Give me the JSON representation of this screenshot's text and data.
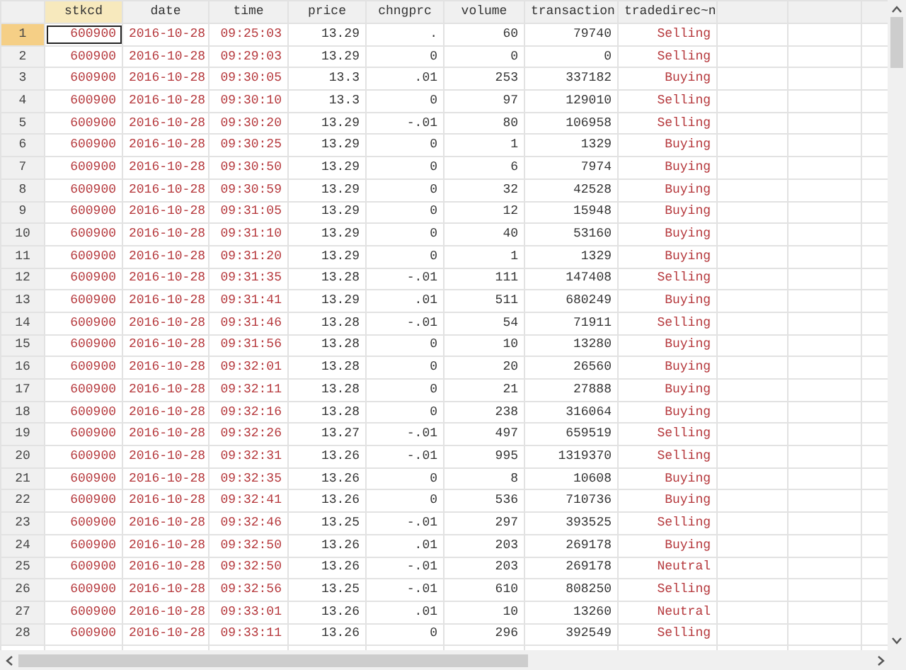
{
  "columns": [
    {
      "label": "stkcd",
      "kind": "string",
      "selected": true
    },
    {
      "label": "date",
      "kind": "string",
      "selected": false
    },
    {
      "label": "time",
      "kind": "string",
      "selected": false
    },
    {
      "label": "price",
      "kind": "numeric",
      "selected": false
    },
    {
      "label": "chngprc",
      "kind": "numeric",
      "selected": false
    },
    {
      "label": "volume",
      "kind": "numeric",
      "selected": false
    },
    {
      "label": "transaction",
      "kind": "numeric",
      "selected": false
    },
    {
      "label": "tradedirec~n",
      "kind": "string",
      "selected": false
    }
  ],
  "rows": [
    {
      "number": "1",
      "selected": true,
      "cells": [
        "600900",
        "2016-10-28",
        "09:25:03",
        "13.29",
        ".",
        "60",
        "79740",
        "Selling"
      ]
    },
    {
      "number": "2",
      "selected": false,
      "cells": [
        "600900",
        "2016-10-28",
        "09:29:03",
        "13.29",
        "0",
        "0",
        "0",
        "Selling"
      ]
    },
    {
      "number": "3",
      "selected": false,
      "cells": [
        "600900",
        "2016-10-28",
        "09:30:05",
        "13.3",
        ".01",
        "253",
        "337182",
        "Buying"
      ]
    },
    {
      "number": "4",
      "selected": false,
      "cells": [
        "600900",
        "2016-10-28",
        "09:30:10",
        "13.3",
        "0",
        "97",
        "129010",
        "Selling"
      ]
    },
    {
      "number": "5",
      "selected": false,
      "cells": [
        "600900",
        "2016-10-28",
        "09:30:20",
        "13.29",
        "-.01",
        "80",
        "106958",
        "Selling"
      ]
    },
    {
      "number": "6",
      "selected": false,
      "cells": [
        "600900",
        "2016-10-28",
        "09:30:25",
        "13.29",
        "0",
        "1",
        "1329",
        "Buying"
      ]
    },
    {
      "number": "7",
      "selected": false,
      "cells": [
        "600900",
        "2016-10-28",
        "09:30:50",
        "13.29",
        "0",
        "6",
        "7974",
        "Buying"
      ]
    },
    {
      "number": "8",
      "selected": false,
      "cells": [
        "600900",
        "2016-10-28",
        "09:30:59",
        "13.29",
        "0",
        "32",
        "42528",
        "Buying"
      ]
    },
    {
      "number": "9",
      "selected": false,
      "cells": [
        "600900",
        "2016-10-28",
        "09:31:05",
        "13.29",
        "0",
        "12",
        "15948",
        "Buying"
      ]
    },
    {
      "number": "10",
      "selected": false,
      "cells": [
        "600900",
        "2016-10-28",
        "09:31:10",
        "13.29",
        "0",
        "40",
        "53160",
        "Buying"
      ]
    },
    {
      "number": "11",
      "selected": false,
      "cells": [
        "600900",
        "2016-10-28",
        "09:31:20",
        "13.29",
        "0",
        "1",
        "1329",
        "Buying"
      ]
    },
    {
      "number": "12",
      "selected": false,
      "cells": [
        "600900",
        "2016-10-28",
        "09:31:35",
        "13.28",
        "-.01",
        "111",
        "147408",
        "Selling"
      ]
    },
    {
      "number": "13",
      "selected": false,
      "cells": [
        "600900",
        "2016-10-28",
        "09:31:41",
        "13.29",
        ".01",
        "511",
        "680249",
        "Buying"
      ]
    },
    {
      "number": "14",
      "selected": false,
      "cells": [
        "600900",
        "2016-10-28",
        "09:31:46",
        "13.28",
        "-.01",
        "54",
        "71911",
        "Selling"
      ]
    },
    {
      "number": "15",
      "selected": false,
      "cells": [
        "600900",
        "2016-10-28",
        "09:31:56",
        "13.28",
        "0",
        "10",
        "13280",
        "Buying"
      ]
    },
    {
      "number": "16",
      "selected": false,
      "cells": [
        "600900",
        "2016-10-28",
        "09:32:01",
        "13.28",
        "0",
        "20",
        "26560",
        "Buying"
      ]
    },
    {
      "number": "17",
      "selected": false,
      "cells": [
        "600900",
        "2016-10-28",
        "09:32:11",
        "13.28",
        "0",
        "21",
        "27888",
        "Buying"
      ]
    },
    {
      "number": "18",
      "selected": false,
      "cells": [
        "600900",
        "2016-10-28",
        "09:32:16",
        "13.28",
        "0",
        "238",
        "316064",
        "Buying"
      ]
    },
    {
      "number": "19",
      "selected": false,
      "cells": [
        "600900",
        "2016-10-28",
        "09:32:26",
        "13.27",
        "-.01",
        "497",
        "659519",
        "Selling"
      ]
    },
    {
      "number": "20",
      "selected": false,
      "cells": [
        "600900",
        "2016-10-28",
        "09:32:31",
        "13.26",
        "-.01",
        "995",
        "1319370",
        "Selling"
      ]
    },
    {
      "number": "21",
      "selected": false,
      "cells": [
        "600900",
        "2016-10-28",
        "09:32:35",
        "13.26",
        "0",
        "8",
        "10608",
        "Buying"
      ]
    },
    {
      "number": "22",
      "selected": false,
      "cells": [
        "600900",
        "2016-10-28",
        "09:32:41",
        "13.26",
        "0",
        "536",
        "710736",
        "Buying"
      ]
    },
    {
      "number": "23",
      "selected": false,
      "cells": [
        "600900",
        "2016-10-28",
        "09:32:46",
        "13.25",
        "-.01",
        "297",
        "393525",
        "Selling"
      ]
    },
    {
      "number": "24",
      "selected": false,
      "cells": [
        "600900",
        "2016-10-28",
        "09:32:50",
        "13.26",
        ".01",
        "203",
        "269178",
        "Buying"
      ]
    },
    {
      "number": "25",
      "selected": false,
      "cells": [
        "600900",
        "2016-10-28",
        "09:32:50",
        "13.26",
        "-.01",
        "203",
        "269178",
        "Neutral"
      ]
    },
    {
      "number": "26",
      "selected": false,
      "cells": [
        "600900",
        "2016-10-28",
        "09:32:56",
        "13.25",
        "-.01",
        "610",
        "808250",
        "Selling"
      ]
    },
    {
      "number": "27",
      "selected": false,
      "cells": [
        "600900",
        "2016-10-28",
        "09:33:01",
        "13.26",
        ".01",
        "10",
        "13260",
        "Neutral"
      ]
    },
    {
      "number": "28",
      "selected": false,
      "cells": [
        "600900",
        "2016-10-28",
        "09:33:11",
        "13.26",
        "0",
        "296",
        "392549",
        "Selling"
      ]
    }
  ]
}
